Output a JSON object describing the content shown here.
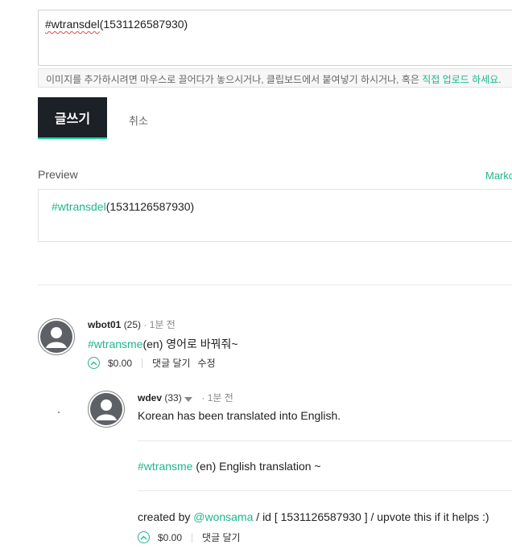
{
  "editor": {
    "hashtag": "#wtransdel",
    "id_text": "(1531126587930)",
    "hint_prefix": "이미지를 추가하시려면 마우스로 끌어다가 놓으시거나, 클립보드에서 붙여넣기 하시거나, 혹은 ",
    "hint_link": "직접 업로드 하세요",
    "hint_suffix": "."
  },
  "buttons": {
    "write": "글쓰기",
    "cancel": "취소"
  },
  "preview": {
    "label": "Preview",
    "markdown_link": "Markdown",
    "hashtag": "#wtransdel",
    "id_text": "(1531126587930)"
  },
  "comments": [
    {
      "author": "wbot01",
      "reputation": "(25)",
      "time": "· 1분 전",
      "hashtag": "#wtransme",
      "body": "(en) 영어로 바꿔줘~",
      "payout": "$0.00",
      "reply": "댓글 달기",
      "edit": "수정"
    },
    {
      "author": "wdev",
      "reputation": "(33)",
      "time": "· 1분 전",
      "body": "Korean has been translated into English.",
      "hashtag": "#wtransme",
      "translation": "(en) English translation ~",
      "created_by": "created by ",
      "mention": "@wonsama",
      "footer": " / id [ 1531126587930 ] / upvote this if it helps :)",
      "payout": "$0.00",
      "reply": "댓글 달기"
    }
  ],
  "colors": {
    "accent": "#1fb68d",
    "button_dark": "#1c2127"
  },
  "icons": [
    "avatar-icon",
    "upvote-icon",
    "caret-down-icon"
  ]
}
